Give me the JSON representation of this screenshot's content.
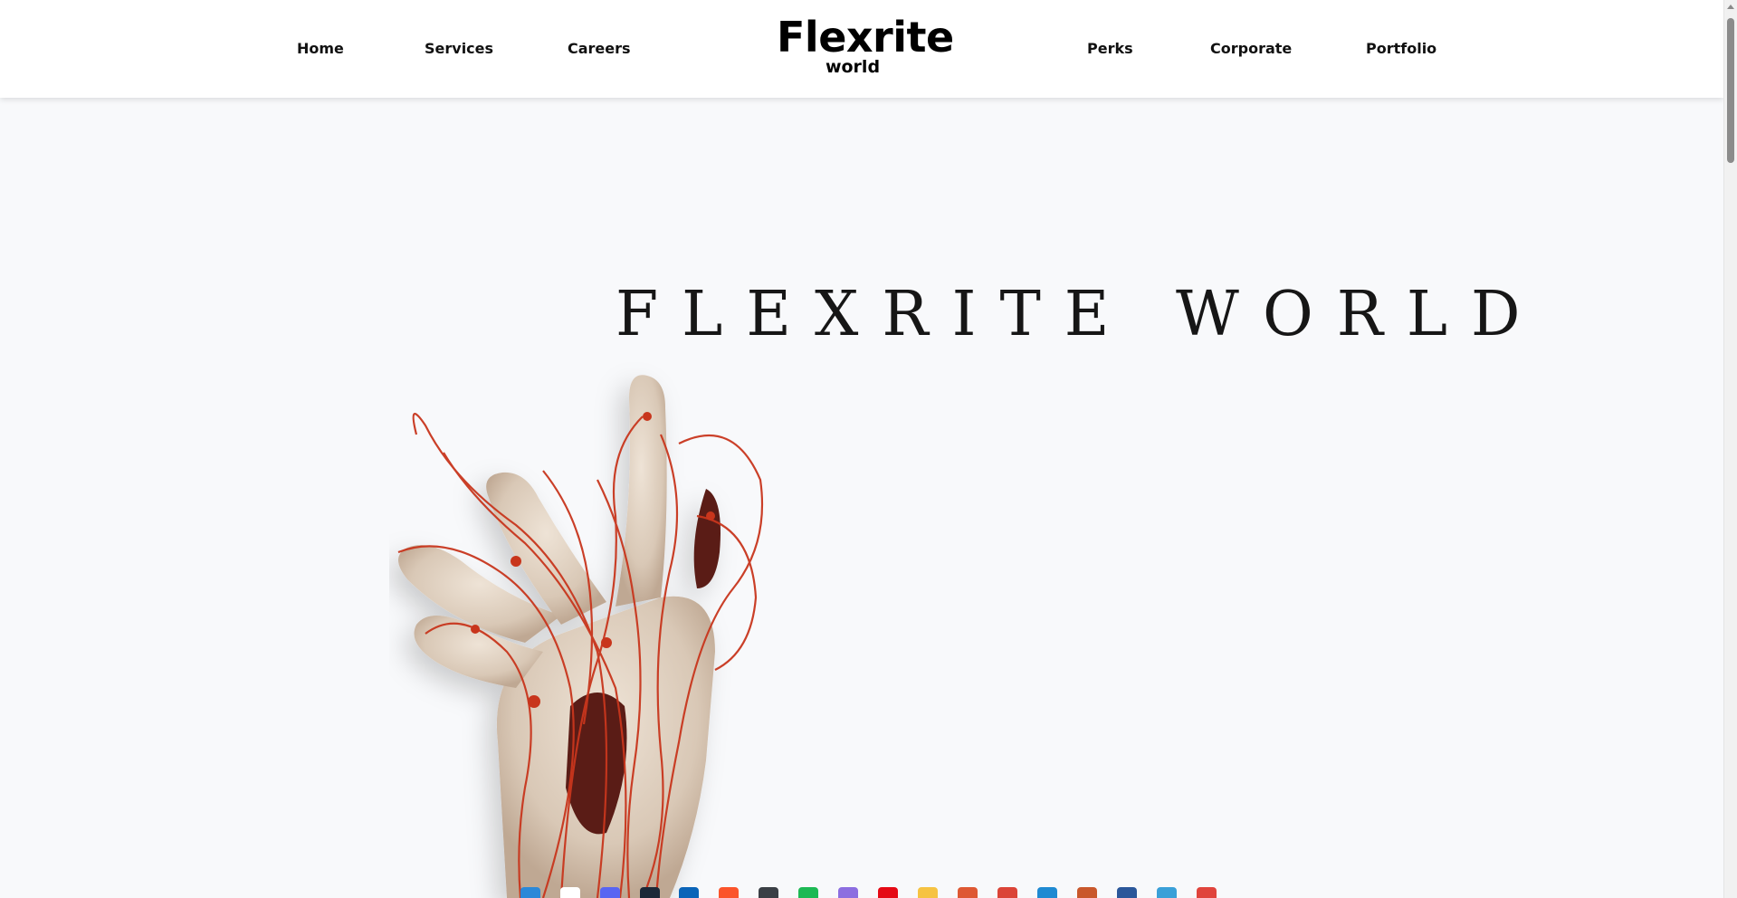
{
  "brand": {
    "name": "Flexrite",
    "subtitle": "world"
  },
  "nav": {
    "left": [
      {
        "label": "Home"
      },
      {
        "label": "Services"
      },
      {
        "label": "Careers"
      }
    ],
    "right": [
      {
        "label": "Perks"
      },
      {
        "label": "Corporate"
      },
      {
        "label": "Portfolio"
      }
    ]
  },
  "hero": {
    "title": "FLEXRITE WORLD",
    "image": "robotic-hand-with-red-wires"
  },
  "taskbar": {
    "icons": [
      {
        "name": "windows-start-icon",
        "color": "#2b88d8"
      },
      {
        "name": "search-icon",
        "color": "#ffffff"
      },
      {
        "name": "discord-icon",
        "color": "#5865f2"
      },
      {
        "name": "steam-icon",
        "color": "#1b2838"
      },
      {
        "name": "outlook-icon",
        "color": "#0a64b8"
      },
      {
        "name": "brave-icon",
        "color": "#fb542b"
      },
      {
        "name": "app-shield-icon",
        "color": "#3a3f45"
      },
      {
        "name": "spotify-icon",
        "color": "#1db954"
      },
      {
        "name": "ethereum-icon",
        "color": "#8c6ee0"
      },
      {
        "name": "netflix-icon",
        "color": "#e50914"
      },
      {
        "name": "file-explorer-icon",
        "color": "#f6c342"
      },
      {
        "name": "duckduckgo-icon",
        "color": "#de5833"
      },
      {
        "name": "chrome-icon",
        "color": "#db4437"
      },
      {
        "name": "vscode-icon",
        "color": "#1f8ad2"
      },
      {
        "name": "chrome-profile-icon",
        "color": "#c9582c"
      },
      {
        "name": "word-icon",
        "color": "#2b579a"
      },
      {
        "name": "notepad-icon",
        "color": "#3aa0d8"
      },
      {
        "name": "snipping-tool-icon",
        "color": "#e0443c"
      }
    ]
  },
  "colors": {
    "background": "#f8f9fb",
    "header": "#ffffff",
    "title": "#161616",
    "accent_wire": "#c8361d"
  }
}
